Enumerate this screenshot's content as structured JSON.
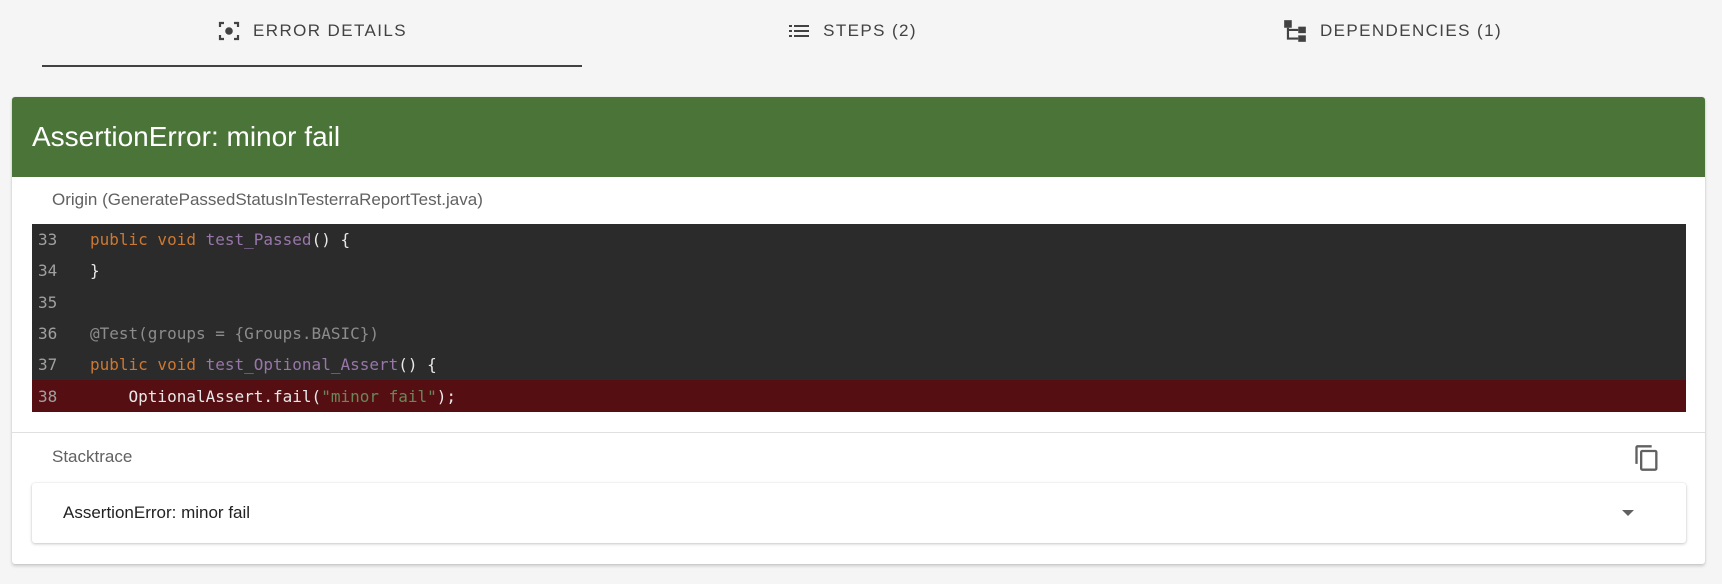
{
  "tabs": [
    {
      "label": "ERROR DETAILS",
      "icon": "camera-focus-icon",
      "active": true
    },
    {
      "label": "STEPS (2)",
      "icon": "list-icon",
      "active": false
    },
    {
      "label": "DEPENDENCIES (1)",
      "icon": "sitemap-icon",
      "active": false
    }
  ],
  "error": {
    "title": "AssertionError: minor fail",
    "header_color": "#4b7439"
  },
  "origin": {
    "label": "Origin (GeneratePassedStatusInTesterraReportTest.java)",
    "lines": [
      {
        "number": "33",
        "code": "public void test_Passed() {"
      },
      {
        "number": "34",
        "code": "}"
      },
      {
        "number": "35",
        "code": ""
      },
      {
        "number": "36",
        "code": "@Test(groups = {Groups.BASIC})"
      },
      {
        "number": "37",
        "code": "public void test_Optional_Assert() {"
      },
      {
        "number": "38",
        "code": "    OptionalAssert.fail(\"minor fail\");",
        "highlight": true
      }
    ]
  },
  "stacktrace": {
    "label": "Stacktrace",
    "copy_icon": "copy-icon",
    "entry": "AssertionError: minor fail",
    "expand_icon": "chevron-down-icon"
  }
}
